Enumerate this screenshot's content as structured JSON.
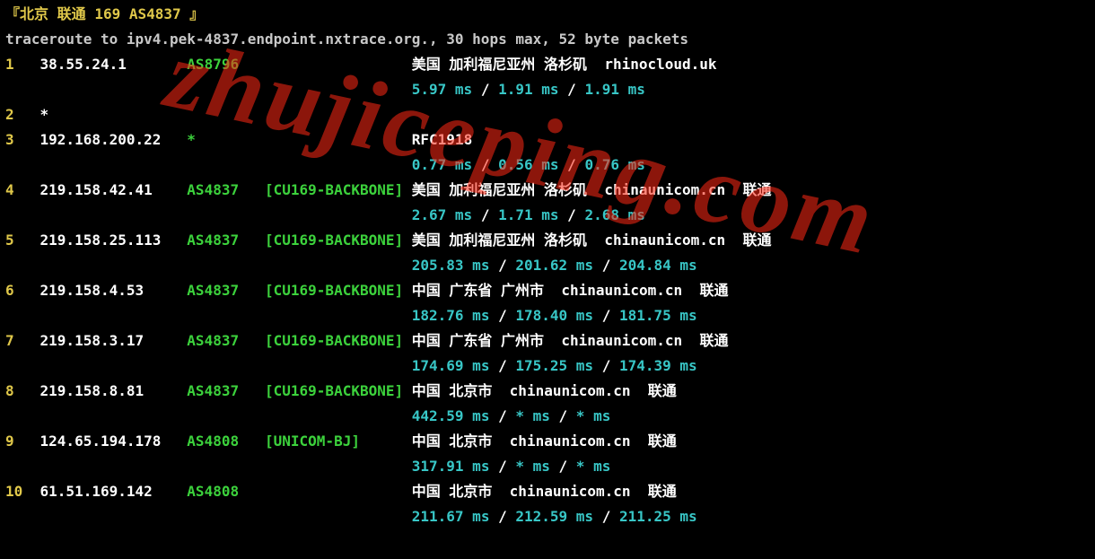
{
  "watermark": "zhujiceping.com",
  "header": {
    "prefix": "『",
    "loc": "北京",
    "isp": "联通",
    "asn": "169",
    "asnum": "AS4837",
    "suffix": " 』"
  },
  "cmd": "traceroute to ipv4.pek-4837.endpoint.nxtrace.org., 30 hops max, 52 byte packets",
  "hops": [
    {
      "n": "1",
      "ip": "38.55.24.1",
      "asn": "AS8796",
      "tag": "",
      "loc": "美国 加利福尼亚州 洛杉矶",
      "host": "rhinocloud.uk",
      "carrier": "",
      "rtt": [
        "5.97 ms",
        "1.91 ms",
        "1.91 ms"
      ]
    },
    {
      "n": "2",
      "ip": "*",
      "asn": "",
      "tag": "",
      "loc": "",
      "host": "",
      "carrier": "",
      "rtt": []
    },
    {
      "n": "3",
      "ip": "192.168.200.22",
      "asn": "*",
      "tag": "",
      "loc": "RFC1918",
      "host": "",
      "carrier": "",
      "rtt": [
        "0.77 ms",
        "0.56 ms",
        "0.76 ms"
      ]
    },
    {
      "n": "4",
      "ip": "219.158.42.41",
      "asn": "AS4837",
      "tag": "[CU169-BACKBONE]",
      "loc": "美国 加利福尼亚州 洛杉矶",
      "host": "chinaunicom.cn",
      "carrier": "联通",
      "rtt": [
        "2.67 ms",
        "1.71 ms",
        "2.68 ms"
      ]
    },
    {
      "n": "5",
      "ip": "219.158.25.113",
      "asn": "AS4837",
      "tag": "[CU169-BACKBONE]",
      "loc": "美国 加利福尼亚州 洛杉矶",
      "host": "chinaunicom.cn",
      "carrier": "联通",
      "rtt": [
        "205.83 ms",
        "201.62 ms",
        "204.84 ms"
      ]
    },
    {
      "n": "6",
      "ip": "219.158.4.53",
      "asn": "AS4837",
      "tag": "[CU169-BACKBONE]",
      "loc": "中国 广东省 广州市",
      "host": "chinaunicom.cn",
      "carrier": "联通",
      "rtt": [
        "182.76 ms",
        "178.40 ms",
        "181.75 ms"
      ]
    },
    {
      "n": "7",
      "ip": "219.158.3.17",
      "asn": "AS4837",
      "tag": "[CU169-BACKBONE]",
      "loc": "中国 广东省 广州市",
      "host": "chinaunicom.cn",
      "carrier": "联通",
      "rtt": [
        "174.69 ms",
        "175.25 ms",
        "174.39 ms"
      ]
    },
    {
      "n": "8",
      "ip": "219.158.8.81",
      "asn": "AS4837",
      "tag": "[CU169-BACKBONE]",
      "loc": "中国 北京市",
      "host": "chinaunicom.cn",
      "carrier": "联通",
      "rtt": [
        "442.59 ms",
        "* ms",
        "* ms"
      ]
    },
    {
      "n": "9",
      "ip": "124.65.194.178",
      "asn": "AS4808",
      "tag": "[UNICOM-BJ]",
      "loc": "中国 北京市",
      "host": "chinaunicom.cn",
      "carrier": "联通",
      "rtt": [
        "317.91 ms",
        "* ms",
        "* ms"
      ]
    },
    {
      "n": "10",
      "ip": "61.51.169.142",
      "asn": "AS4808",
      "tag": "",
      "loc": "中国 北京市",
      "host": "chinaunicom.cn",
      "carrier": "联通",
      "rtt": [
        "211.67 ms",
        "212.59 ms",
        "211.25 ms"
      ]
    }
  ]
}
